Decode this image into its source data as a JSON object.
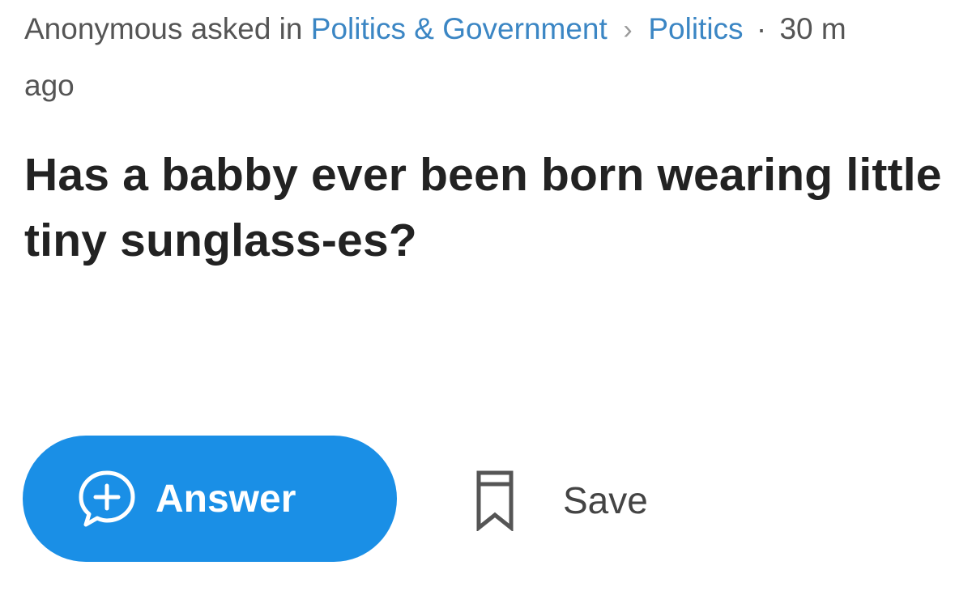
{
  "meta": {
    "asker": "Anonymous asked in",
    "category": "Politics & Government",
    "subcategory": "Politics",
    "separator": "·",
    "time_start": "30 m",
    "time_end": "ago"
  },
  "question": {
    "title": "Has a babby ever been born wearing little tiny sunglass-es?"
  },
  "actions": {
    "answer_label": "Answer",
    "save_label": "Save"
  },
  "icons": {
    "chevron": "chevron-right-icon",
    "answer": "plus-speech-bubble-icon",
    "save": "bookmark-icon"
  },
  "colors": {
    "link": "#3b86c4",
    "answer_button": "#1a8fe6",
    "title": "#222222",
    "meta": "#555555"
  }
}
